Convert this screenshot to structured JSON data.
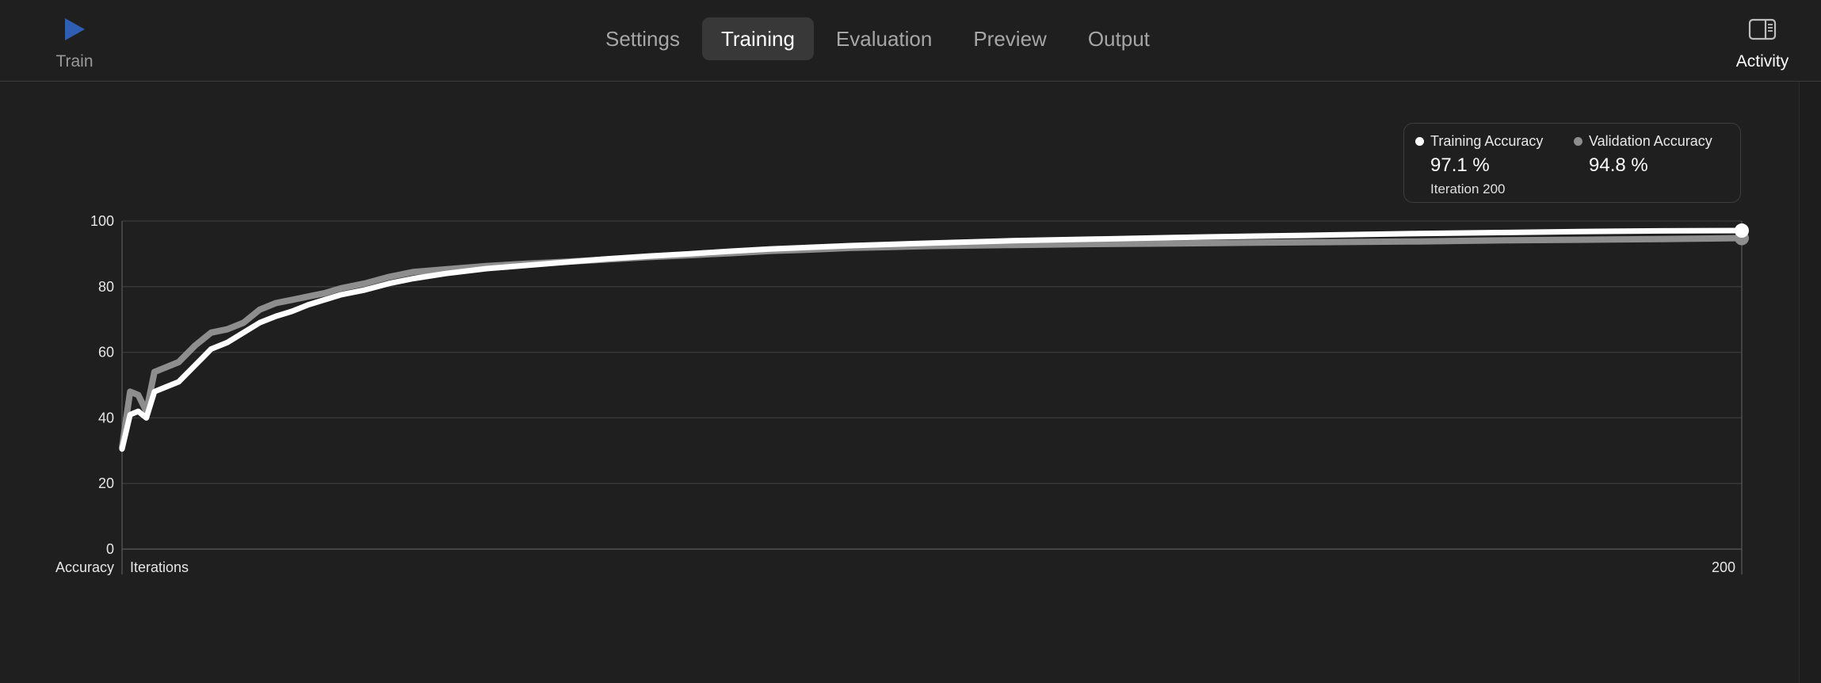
{
  "toolbar": {
    "train_label": "Train",
    "activity_label": "Activity",
    "tabs": [
      {
        "label": "Settings",
        "active": false
      },
      {
        "label": "Training",
        "active": true
      },
      {
        "label": "Evaluation",
        "active": false
      },
      {
        "label": "Preview",
        "active": false
      },
      {
        "label": "Output",
        "active": false
      }
    ],
    "train_icon": "play-icon",
    "activity_icon": "sidebar-icon",
    "accent_color": "#2f5fb3"
  },
  "legend": {
    "training_label": "Training Accuracy",
    "training_value": "97.1 %",
    "validation_label": "Validation Accuracy",
    "validation_value": "94.8 %",
    "iteration_text": "Iteration 200",
    "training_color": "#ffffff",
    "validation_color": "#8e8e8e"
  },
  "chart_data": {
    "type": "line",
    "xlabel": "Iterations",
    "ylabel": "Accuracy",
    "ylim": [
      0,
      100
    ],
    "xlim": [
      0,
      200
    ],
    "yticks": [
      0,
      20,
      40,
      60,
      80,
      100
    ],
    "xtick_end": "200",
    "grid": true,
    "legend_position": "top-right",
    "series": [
      {
        "name": "Training Accuracy",
        "color": "#ffffff",
        "x": [
          0,
          1,
          2,
          3,
          4,
          5,
          7,
          9,
          11,
          13,
          15,
          17,
          19,
          21,
          23,
          25,
          27,
          30,
          33,
          36,
          40,
          45,
          50,
          55,
          60,
          65,
          70,
          75,
          80,
          85,
          90,
          95,
          100,
          110,
          120,
          130,
          140,
          150,
          160,
          170,
          180,
          190,
          200
        ],
        "y": [
          30.5,
          41,
          42,
          40,
          48,
          49,
          51,
          56,
          61,
          63,
          66,
          69,
          71,
          72.5,
          74.5,
          76,
          77.5,
          79,
          81,
          82.5,
          84,
          85.5,
          86.5,
          87.5,
          88.5,
          89.3,
          90,
          90.8,
          91.5,
          92,
          92.5,
          92.9,
          93.3,
          94,
          94.5,
          95,
          95.4,
          95.8,
          96.2,
          96.5,
          96.8,
          97,
          97.1
        ]
      },
      {
        "name": "Validation Accuracy",
        "color": "#8e8e8e",
        "x": [
          0,
          1,
          2,
          3,
          4,
          5,
          7,
          9,
          11,
          13,
          15,
          17,
          19,
          21,
          23,
          25,
          27,
          30,
          33,
          36,
          40,
          45,
          50,
          55,
          60,
          65,
          70,
          75,
          80,
          85,
          90,
          95,
          100,
          110,
          120,
          130,
          140,
          150,
          160,
          170,
          180,
          190,
          200
        ],
        "y": [
          31,
          48,
          47,
          42,
          54,
          55,
          57,
          62,
          66,
          67,
          69,
          73,
          75,
          76,
          77,
          78,
          79.5,
          81,
          83,
          84.5,
          85.3,
          86.3,
          87,
          87.6,
          88.3,
          89,
          89.6,
          90.2,
          90.9,
          91.3,
          91.8,
          92.1,
          92.4,
          92.7,
          93,
          93.2,
          93.4,
          93.6,
          93.8,
          94.1,
          94.3,
          94.5,
          94.8
        ]
      }
    ]
  }
}
